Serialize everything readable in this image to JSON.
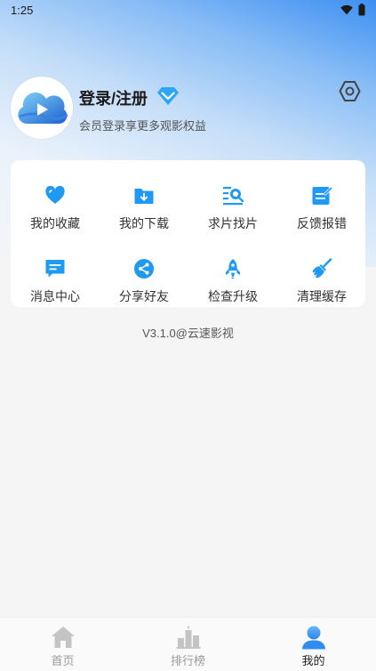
{
  "status_bar": {
    "time": "1:25"
  },
  "profile": {
    "title": "登录/注册",
    "subtitle": "会员登录享更多观影权益"
  },
  "menu": [
    {
      "label": "我的收藏",
      "icon": "heart-icon"
    },
    {
      "label": "我的下载",
      "icon": "download-folder-icon"
    },
    {
      "label": "求片找片",
      "icon": "search-list-icon"
    },
    {
      "label": "反馈报错",
      "icon": "feedback-edit-icon"
    },
    {
      "label": "消息中心",
      "icon": "message-icon"
    },
    {
      "label": "分享好友",
      "icon": "share-icon"
    },
    {
      "label": "检查升级",
      "icon": "rocket-icon"
    },
    {
      "label": "清理缓存",
      "icon": "broom-icon"
    }
  ],
  "version": "V3.1.0@云速影视",
  "tabs": [
    {
      "label": "首页",
      "icon": "home-icon",
      "active": false
    },
    {
      "label": "排行榜",
      "icon": "ranking-icon",
      "active": false
    },
    {
      "label": "我的",
      "icon": "user-icon",
      "active": true
    }
  ],
  "colors": {
    "accent": "#1e9af3",
    "tab_active": "#2e8ef0",
    "tab_inactive": "#c4c4c4"
  }
}
